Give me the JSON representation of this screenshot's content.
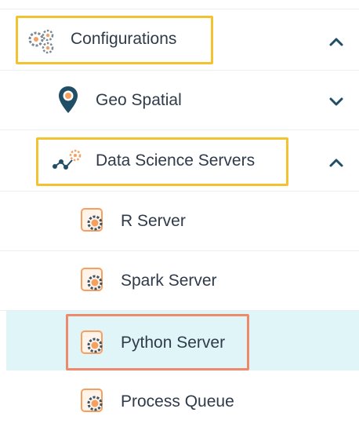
{
  "menu": {
    "configurations": {
      "label": "Configurations",
      "icon": "gears-icon",
      "state": "expanded"
    },
    "geo_spatial": {
      "label": "Geo Spatial",
      "icon": "map-pin-icon",
      "state": "collapsed"
    },
    "data_science_servers": {
      "label": "Data Science Servers",
      "icon": "network-gear-icon",
      "state": "expanded"
    },
    "servers": [
      {
        "label": "R Server",
        "icon": "server-gear-icon"
      },
      {
        "label": "Spark Server",
        "icon": "server-gear-icon"
      },
      {
        "label": "Python Server",
        "icon": "server-gear-icon",
        "selected": true
      },
      {
        "label": "Process Queue",
        "icon": "server-gear-icon"
      }
    ]
  },
  "colors": {
    "highlight_box": "#f2c230",
    "selected_box": "#ee8a6b",
    "selected_bg": "#e0f5f7",
    "icon_orange": "#f5a060",
    "chevron": "#1f4e66"
  }
}
